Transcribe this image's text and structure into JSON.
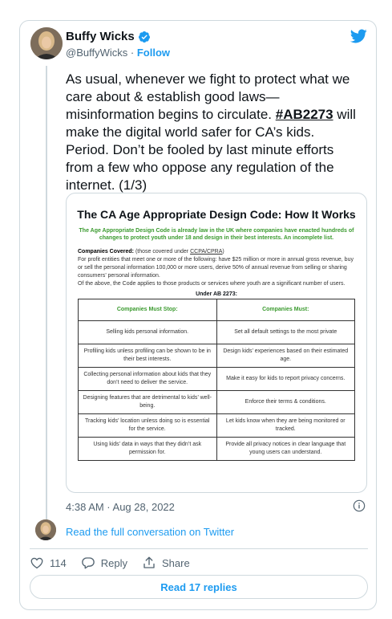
{
  "author": {
    "name": "Buffy Wicks",
    "handle": "@BuffyWicks",
    "separator": "·",
    "follow_label": "Follow",
    "icons": {
      "verified": "verified-badge-icon",
      "logo": "twitter-bird-icon"
    }
  },
  "tweet": {
    "text_before": "As usual, whenever we fight to protect what we care about & establish good laws—misinformation begins to circulate. ",
    "hashtag": "#AB2273",
    "text_after": " will make the digital world safer for CA’s kids. Period. Don’t be fooled by last minute efforts from a few who oppose any regulation of the internet. (1/3)"
  },
  "media": {
    "title": "The CA Age Appropriate Design Code: How It Works",
    "subtitle": "The Age Appropriate Design Code is already law in the UK where companies have enacted hundreds of changes to protect youth under 18 and design in their best interests. An incomplete list.",
    "covered_label": "Companies Covered:",
    "covered_paren_before": " (those covered under ",
    "covered_link": "CCPA/CPRA",
    "covered_paren_after": ")",
    "covered_p1": "For profit entities that meet one or more of the following: have $25 million or more in annual gross revenue, buy or sell the personal information 100,000 or more users, derive 50% of annual revenue from selling or sharing consumers’ personal information.",
    "covered_p2": "Of the above, the Code applies to those products or services where youth are a significant number of users.",
    "under_label": "Under AB 2273:",
    "table": {
      "headers": [
        "Companies Must Stop:",
        "Companies Must:"
      ],
      "rows": [
        [
          "Selling kids personal information.",
          "Set all default settings to the most private"
        ],
        [
          "Profiling kids unless profiling can be shown to be in their best interests.",
          "Design kids’ experiences based on their estimated age."
        ],
        [
          "Collecting personal information about kids that they don’t need to deliver the service.",
          "Make it easy for kids to report privacy concerns."
        ],
        [
          "Designing features that are detrimental to kids’ well-being.",
          "Enforce their terms & conditions."
        ],
        [
          "Tracking kids’ location unless doing so is essential for the service.",
          "Let kids know when they are being monitored or tracked."
        ],
        [
          "Using kids’ data in ways that they didn’t ask permission for.",
          "Provide all privacy notices in clear language that young users can understand."
        ]
      ]
    }
  },
  "timestamp": "4:38 AM · Aug 28, 2022",
  "read_conversation": "Read the full conversation on Twitter",
  "actions": {
    "likes": "114",
    "reply": "Reply",
    "share": "Share"
  },
  "read_replies": "Read 17 replies",
  "colors": {
    "accent": "#1d9bf0",
    "secondary_text": "#536471",
    "border": "#cfd9de",
    "media_green": "#3a9a2e"
  }
}
